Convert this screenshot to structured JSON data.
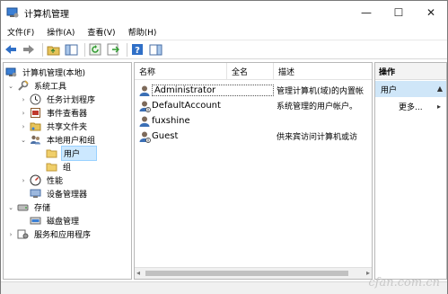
{
  "window": {
    "title": "计算机管理",
    "minimize": "—",
    "maximize": "☐",
    "close": "✕"
  },
  "menu": [
    "文件(F)",
    "操作(A)",
    "查看(V)",
    "帮助(H)"
  ],
  "tree": [
    {
      "label": "计算机管理(本地)"
    },
    {
      "label": "系统工具"
    },
    {
      "label": "任务计划程序"
    },
    {
      "label": "事件查看器"
    },
    {
      "label": "共享文件夹"
    },
    {
      "label": "本地用户和组"
    },
    {
      "label": "用户"
    },
    {
      "label": "组"
    },
    {
      "label": "性能"
    },
    {
      "label": "设备管理器"
    },
    {
      "label": "存储"
    },
    {
      "label": "磁盘管理"
    },
    {
      "label": "服务和应用程序"
    }
  ],
  "list": {
    "columns": [
      "名称",
      "全名",
      "描述"
    ],
    "rows": [
      {
        "name": "Administrator",
        "fullname": "",
        "desc": "管理计算机(域)的内置帐"
      },
      {
        "name": "DefaultAccount",
        "fullname": "",
        "desc": "系统管理的用户帐户。"
      },
      {
        "name": "fuxshine",
        "fullname": "",
        "desc": ""
      },
      {
        "name": "Guest",
        "fullname": "",
        "desc": "供来宾访问计算机或访"
      }
    ]
  },
  "actions": {
    "header": "操作",
    "selected": "用户",
    "more": "更多..."
  },
  "watermark": "cfan.com.cn",
  "colors": {
    "selection": "#cce8ff",
    "action_selected": "#cfe6f8"
  }
}
